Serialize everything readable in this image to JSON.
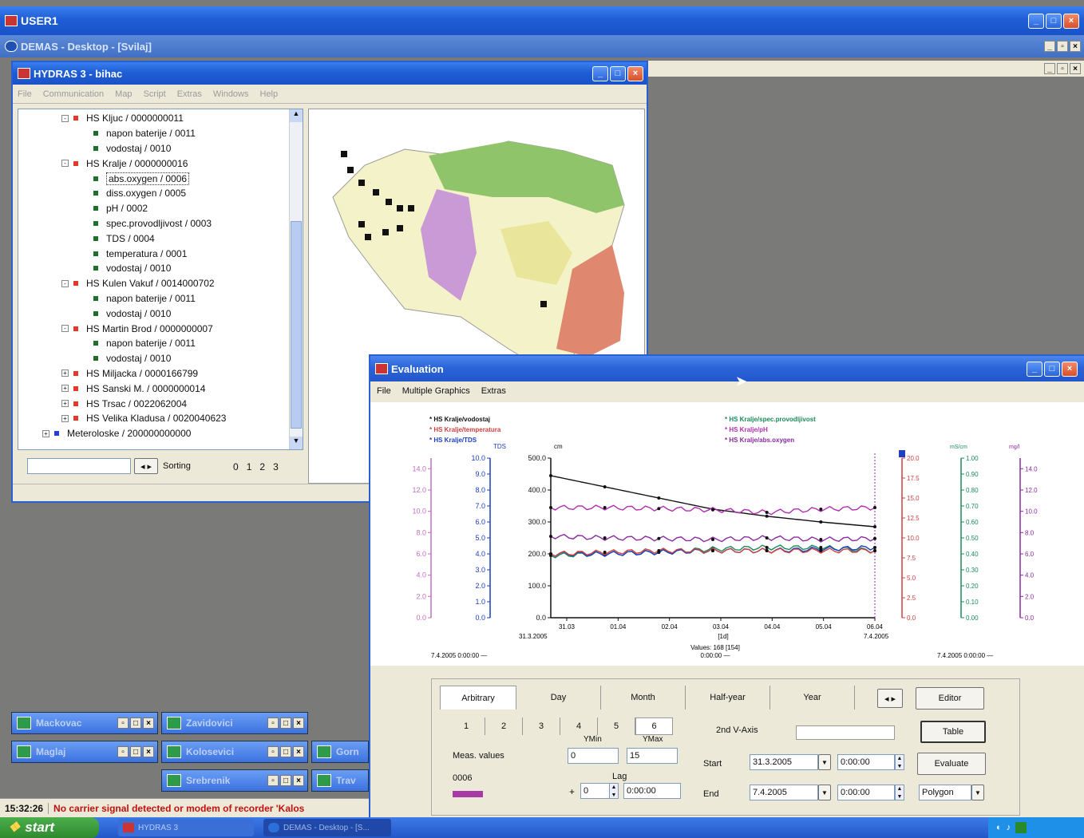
{
  "user_window": {
    "title": "USER1"
  },
  "demas_window": {
    "title": "DEMAS - Desktop - [Svilaj]"
  },
  "hydras_window": {
    "title": "HYDRAS 3 - bihac",
    "menu": [
      "File",
      "Communication",
      "Map",
      "Script",
      "Extras",
      "Windows",
      "Help"
    ],
    "tree": [
      {
        "label": "HS Kljuc / 0000000011",
        "level": 1,
        "color": "#e23a2a",
        "expander": "-"
      },
      {
        "label": "napon baterije / 0011",
        "level": 2,
        "color": "#1f6e2a"
      },
      {
        "label": "vodostaj / 0010",
        "level": 2,
        "color": "#1f6e2a"
      },
      {
        "label": "HS Kralje / 0000000016",
        "level": 1,
        "color": "#e23a2a",
        "expander": "-"
      },
      {
        "label": "abs.oxygen / 0006",
        "level": 2,
        "color": "#1f6e2a",
        "selected": true
      },
      {
        "label": "diss.oxygen / 0005",
        "level": 2,
        "color": "#1f6e2a"
      },
      {
        "label": "pH / 0002",
        "level": 2,
        "color": "#1f6e2a"
      },
      {
        "label": "spec.provodljivost / 0003",
        "level": 2,
        "color": "#1f6e2a"
      },
      {
        "label": "TDS / 0004",
        "level": 2,
        "color": "#1f6e2a"
      },
      {
        "label": "temperatura / 0001",
        "level": 2,
        "color": "#1f6e2a"
      },
      {
        "label": "vodostaj / 0010",
        "level": 2,
        "color": "#1f6e2a"
      },
      {
        "label": "HS Kulen Vakuf / 0014000702",
        "level": 1,
        "color": "#e23a2a",
        "expander": "-"
      },
      {
        "label": "napon baterije / 0011",
        "level": 2,
        "color": "#1f6e2a"
      },
      {
        "label": "vodostaj / 0010",
        "level": 2,
        "color": "#1f6e2a"
      },
      {
        "label": "HS Martin Brod / 0000000007",
        "level": 1,
        "color": "#e23a2a",
        "expander": "-"
      },
      {
        "label": "napon baterije / 0011",
        "level": 2,
        "color": "#1f6e2a"
      },
      {
        "label": "vodostaj / 0010",
        "level": 2,
        "color": "#1f6e2a"
      },
      {
        "label": "HS Miljacka / 0000166799",
        "level": 1,
        "color": "#e23a2a",
        "expander": "+"
      },
      {
        "label": "HS Sanski M. / 0000000014",
        "level": 1,
        "color": "#e23a2a",
        "expander": "+"
      },
      {
        "label": "HS Trsac / 0022062004",
        "level": 1,
        "color": "#e23a2a",
        "expander": "+"
      },
      {
        "label": "HS Velika Kladusa / 0020040623",
        "level": 1,
        "color": "#e23a2a",
        "expander": "+"
      },
      {
        "label": "Meteroloske / 200000000000",
        "level": 0,
        "color": "#2a3fd0",
        "expander": "+"
      }
    ],
    "sorting_label": "Sorting",
    "sort_levels": [
      "0",
      "1",
      "2",
      "3"
    ]
  },
  "evaluation_window": {
    "title": "Evaluation",
    "menu": [
      "File",
      "Multiple Graphics",
      "Extras"
    ],
    "legend_left": [
      {
        "label": "HS Kralje/vodostaj",
        "color": "#111111"
      },
      {
        "label": "HS Kralje/temperatura",
        "color": "#d04040"
      },
      {
        "label": "HS Kralje/TDS",
        "color": "#1a3fc0"
      }
    ],
    "legend_right": [
      {
        "label": "HS Kralje/spec.provodljivost",
        "color": "#1a8a5a"
      },
      {
        "label": "HS Kralje/pH",
        "color": "#b02fb0"
      },
      {
        "label": "HS Kralje/abs.oxygen",
        "color": "#8a2aa0"
      }
    ],
    "units": {
      "tds": "TDS",
      "cm": "cm",
      "ms": "mS/cm",
      "mgl": "mg/l"
    },
    "x_ticks": [
      "31.03",
      "01.04",
      "02.04",
      "03.04",
      "04.04",
      "05.04",
      "06.04"
    ],
    "x_start": "31.3.2005",
    "x_end": "7.4.2005",
    "x_unit": "[1d]",
    "values_text": "Values: 168 [154]",
    "time_center": "0:00:00",
    "time_left": "7.4.2005 0:00:00",
    "time_right": "7.4.2005 0:00:00",
    "tabs": [
      "Arbitrary",
      "Day",
      "Month",
      "Half-year",
      "Year"
    ],
    "subtabs": [
      "1",
      "2",
      "3",
      "4",
      "5",
      "6"
    ],
    "editor_label": "Editor",
    "second_axis_label": "2nd V-Axis",
    "table_label": "Table",
    "evaluate_label": "Evaluate",
    "ymin_label": "YMin",
    "ymax_label": "YMax",
    "ymin_value": "0",
    "ymax_value": "15",
    "meas_label": "Meas. values",
    "channel_code": "0006",
    "lag_label": "Lag",
    "lag_sign": "+",
    "lag_value": "0",
    "lag_time": "0:00:00",
    "start_label": "Start",
    "end_label": "End",
    "start_date": "31.3.2005",
    "start_time": "0:00:00",
    "end_date": "7.4.2005",
    "end_time": "0:00:00",
    "mode_value": "Polygon"
  },
  "minimized_windows": [
    {
      "name": "Mackovac"
    },
    {
      "name": "Zavidovici"
    },
    {
      "name": "Maglaj"
    },
    {
      "name": "Kolosevici"
    },
    {
      "name": "Gorn"
    },
    {
      "name": "Srebrenik"
    },
    {
      "name": "Trav"
    }
  ],
  "status_bar": {
    "time": "15:32:26",
    "message": "No carrier signal detected or modem of recorder 'Kalos"
  },
  "taskbar": {
    "start_label": "start",
    "items": [
      "HYDRAS 3",
      "DEMAS - Desktop - [S..."
    ]
  },
  "chart_data": {
    "type": "line",
    "title": "",
    "x": [
      "31.03",
      "01.04",
      "02.04",
      "03.04",
      "04.04",
      "05.04",
      "06.04"
    ],
    "ylim": [
      0,
      500
    ],
    "ylabel": "cm",
    "series": [
      {
        "name": "HS Kralje/vodostaj",
        "color": "#111111",
        "values": [
          445,
          410,
          375,
          340,
          318,
          300,
          285
        ]
      },
      {
        "name": "HS Kralje/pH",
        "color": "#b02fb0",
        "values": [
          345,
          345,
          342,
          338,
          330,
          340,
          345
        ]
      },
      {
        "name": "HS Kralje/abs.oxygen",
        "color": "#8a2aa0",
        "values": [
          255,
          250,
          248,
          245,
          250,
          245,
          248
        ]
      },
      {
        "name": "HS Kralje/spec.provodljivost",
        "color": "#1a8a5a",
        "values": [
          195,
          200,
          205,
          215,
          220,
          220,
          210
        ]
      },
      {
        "name": "HS Kralje/TDS",
        "color": "#1a3fc0",
        "values": [
          200,
          200,
          205,
          210,
          210,
          215,
          220
        ]
      },
      {
        "name": "HS Kralje/temperatura",
        "color": "#d04040",
        "values": [
          200,
          205,
          210,
          210,
          210,
          210,
          210
        ]
      }
    ]
  }
}
